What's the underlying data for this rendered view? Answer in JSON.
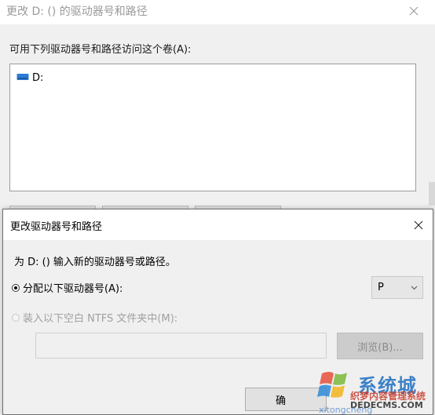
{
  "background_dialog": {
    "title": "更改 D: () 的驱动器号和路径",
    "list_label": "可用下列驱动器号和路径访问这个卷(A):",
    "list_items": [
      {
        "label": "D:",
        "icon": "drive-icon"
      }
    ]
  },
  "foreground_dialog": {
    "title": "更改驱动器号和路径",
    "instruction": "为 D: () 输入新的驱动器号或路径。",
    "assign_option": {
      "label": "分配以下驱动器号(A):",
      "selected": true
    },
    "drive_letter": {
      "value": "P"
    },
    "mount_option": {
      "label": "装入以下空白 NTFS 文件夹中(M):",
      "selected": false,
      "disabled": true
    },
    "path_input": {
      "value": ""
    },
    "browse_button": {
      "label": "浏览(B)..."
    },
    "ok_button": {
      "label": "确"
    }
  },
  "watermark": {
    "brand": "系统城",
    "line1": "织梦内容管理系统",
    "line2": "DEDECMS.COM",
    "line3": "xitongcheng"
  },
  "colors": {
    "window_bg": "#f0f0f0",
    "titlebar": "#ffffff",
    "disabled_text": "#a0a0a0",
    "drive_icon": "#2b7bd6"
  }
}
